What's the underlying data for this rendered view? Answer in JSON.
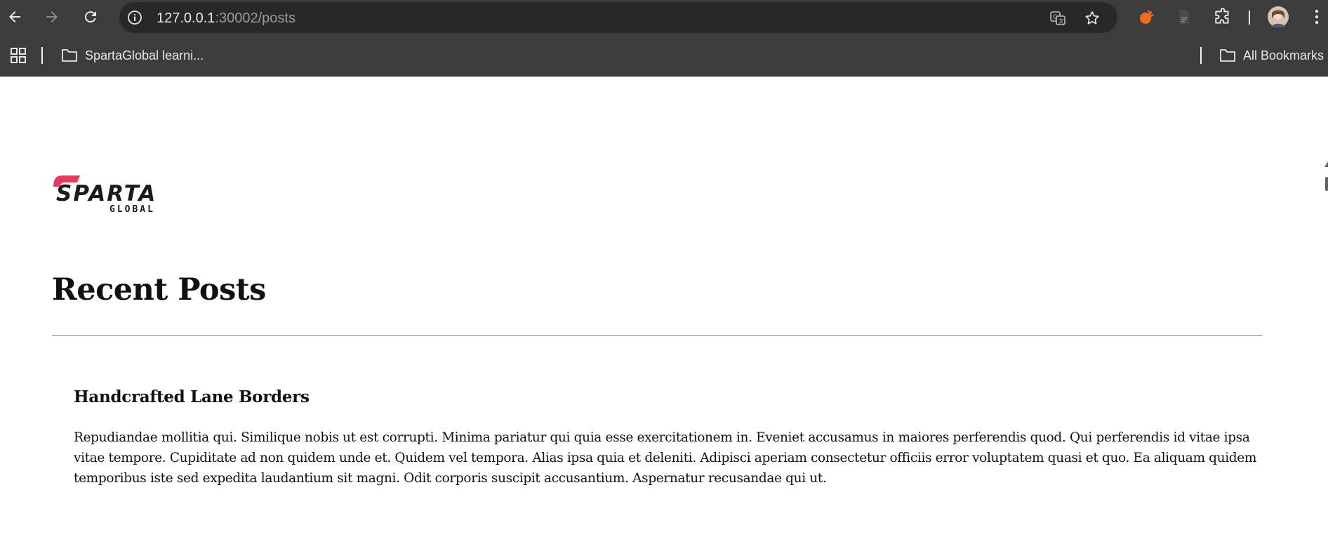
{
  "browser": {
    "url_host": "127.0.0.1",
    "url_path": ":30002/posts",
    "icons": {
      "back": "back-arrow-icon",
      "forward": "forward-arrow-icon",
      "reload": "reload-icon",
      "site_info": "site-info-icon",
      "translate": "translate-icon",
      "bookmark": "star-icon",
      "extensions": "puzzle-icon",
      "menu": "kebab-menu-icon"
    }
  },
  "bookmarks": {
    "folder_label": "SpartaGlobal learni...",
    "all_bookmarks_label": "All Bookmarks"
  },
  "page": {
    "logo_text": "SPARTA",
    "logo_subtext": "GLOBAL",
    "logo_accent": "#e83a5e",
    "title": "Recent Posts",
    "posts": [
      {
        "title": "Handcrafted Lane Borders",
        "body": "Repudiandae mollitia qui. Similique nobis ut est corrupti. Minima pariatur qui quia esse exercitationem in. Eveniet accusamus in maiores perferendis quod. Qui perferendis id vitae ipsa vitae tempore. Cupiditate ad non quidem unde et. Quidem vel tempora. Alias ipsa quia et deleniti. Adipisci aperiam consectetur officiis error voluptatem quasi et quo. Ea aliquam quidem temporibus iste sed expedita laudantium sit magni. Odit corporis suscipit accusantium. Aspernatur recusandae qui ut."
      }
    ]
  }
}
